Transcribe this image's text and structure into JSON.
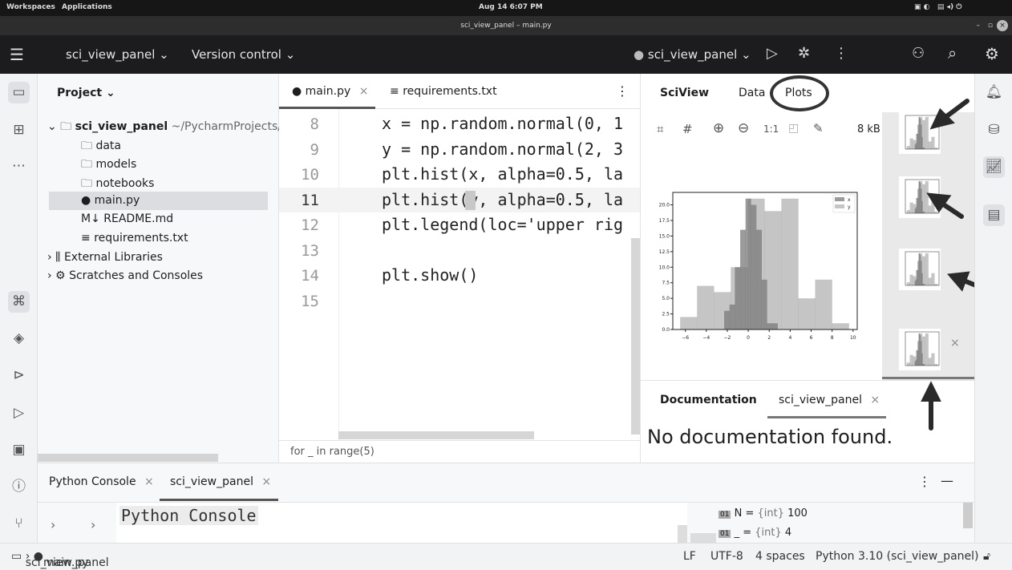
{
  "os": {
    "workspaces": "Workspaces",
    "applications": "Applications",
    "clock": "Aug 14  6:07 PM"
  },
  "window": {
    "title": "sci_view_panel – main.py"
  },
  "toolbar": {
    "project": "sci_view_panel",
    "vcs": "Version control",
    "run_config": "sci_view_panel"
  },
  "project_panel": {
    "title": "Project",
    "root": "sci_view_panel",
    "root_path": "~/PycharmProjects/sci_view_panel",
    "items": [
      "data",
      "models",
      "notebooks",
      "main.py",
      "README.md",
      "requirements.txt"
    ],
    "external": "External Libraries",
    "scratches": "Scratches and Consoles"
  },
  "editor": {
    "tabs": [
      "main.py",
      "requirements.txt"
    ],
    "lines": [
      {
        "n": "8",
        "code": "x = np.random.normal(0, 1"
      },
      {
        "n": "9",
        "code": "y = np.random.normal(2, 3"
      },
      {
        "n": "10",
        "code": "plt.hist(x, alpha=0.5, la"
      },
      {
        "n": "11",
        "code": "plt.hist(y, alpha=0.5, la"
      },
      {
        "n": "12",
        "code": "plt.legend(loc='upper rig"
      },
      {
        "n": "13",
        "code": ""
      },
      {
        "n": "14",
        "code": "plt.show()"
      },
      {
        "n": "15",
        "code": ""
      }
    ],
    "current_line": "11",
    "breadcrumb": "for _ in range(5)"
  },
  "sciview": {
    "title": "SciView",
    "tabs": [
      "Data",
      "Plots"
    ],
    "active_tab": "Plots",
    "zoom_actual": "1:1",
    "size": "8 kB",
    "doc_title": "Documentation",
    "doc_tab": "sci_view_panel",
    "doc_text": "No documentation found.",
    "thumbnail_count": 4
  },
  "chart_data": {
    "type": "bar",
    "subtype": "overlapping histogram",
    "xlim": [
      -7.2,
      10.4
    ],
    "ylim": [
      0,
      22
    ],
    "xticks": [
      "−6",
      "−4",
      "−2",
      "0",
      "2",
      "4",
      "6",
      "8",
      "10"
    ],
    "yticks": [
      "0.0",
      "2.5",
      "5.0",
      "7.5",
      "10.0",
      "12.5",
      "15.0",
      "17.5",
      "20.0"
    ],
    "legend_placement": "upper right",
    "series": [
      {
        "name": "x",
        "color": "#7a7a7a",
        "bin_edges": [
          -2.3,
          -1.79,
          -1.28,
          -0.77,
          -0.26,
          0.25,
          0.76,
          1.27,
          1.78,
          2.29,
          2.8
        ],
        "counts": [
          3,
          4,
          10,
          16,
          21,
          20,
          16,
          8,
          1,
          1
        ]
      },
      {
        "name": "y",
        "color": "#9e9e9e",
        "bin_edges": [
          -6.5,
          -4.89,
          -3.28,
          -1.67,
          -0.06,
          1.55,
          3.16,
          4.77,
          6.38,
          7.99,
          9.6
        ],
        "counts": [
          2,
          7,
          6,
          10,
          21,
          19,
          21,
          5,
          8,
          1
        ]
      }
    ]
  },
  "bottom": {
    "tabs": [
      "Python Console",
      "sci_view_panel"
    ],
    "console_title": "Python Console",
    "vars": [
      {
        "name": "N",
        "type": "{int}",
        "value": "100"
      },
      {
        "name": "_",
        "type": "{int}",
        "value": "4"
      }
    ]
  },
  "status": {
    "crumb_project": "sci_view_panel",
    "crumb_file": "main.py",
    "line_sep": "LF",
    "encoding": "UTF-8",
    "indent": "4 spaces",
    "interpreter": "Python 3.10 (sci_view_panel)"
  }
}
